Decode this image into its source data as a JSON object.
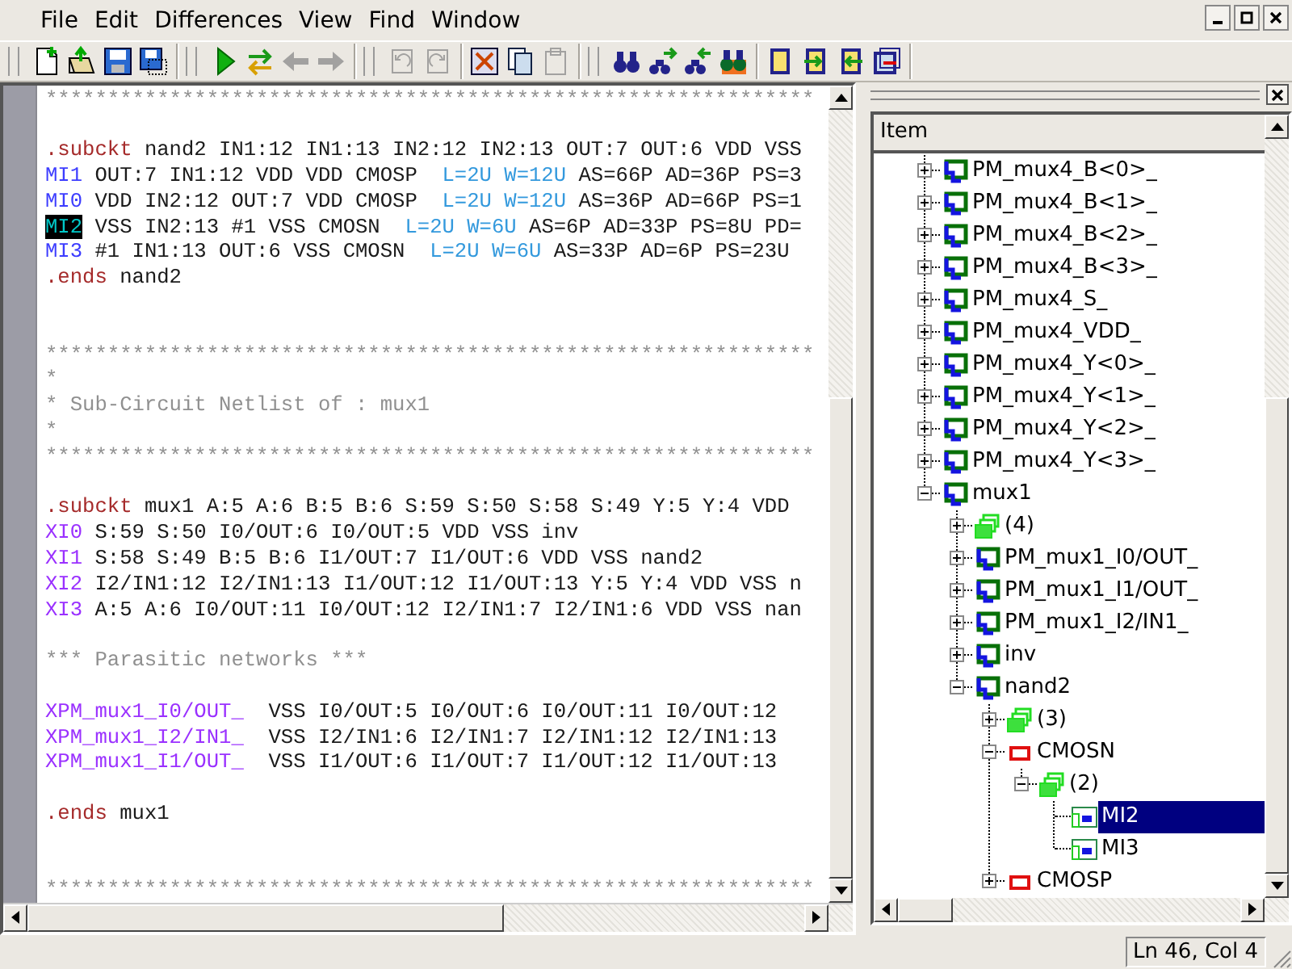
{
  "menu": [
    {
      "label": "File"
    },
    {
      "label": "Edit"
    },
    {
      "label": "Differences"
    },
    {
      "label": "View"
    },
    {
      "label": "Find"
    },
    {
      "label": "Window"
    }
  ],
  "toolbar": [
    {
      "handle": true,
      "buttons": [
        {
          "kind": "new",
          "disabled": false
        },
        {
          "kind": "open",
          "disabled": false
        },
        {
          "kind": "save",
          "disabled": false
        },
        {
          "kind": "saveall",
          "disabled": false
        }
      ]
    },
    {
      "handle": true,
      "buttons": [
        {
          "kind": "run",
          "disabled": false
        },
        {
          "kind": "swap",
          "disabled": false
        },
        {
          "kind": "back",
          "disabled": true
        },
        {
          "kind": "forward",
          "disabled": true
        }
      ]
    },
    {
      "handle": true,
      "buttons": [
        {
          "kind": "undo",
          "disabled": true
        },
        {
          "kind": "redo",
          "disabled": true
        }
      ]
    },
    {
      "handle": false,
      "buttons": [
        {
          "kind": "cut",
          "disabled": false
        },
        {
          "kind": "copy",
          "disabled": false
        },
        {
          "kind": "paste",
          "disabled": true
        }
      ]
    },
    {
      "handle": true,
      "buttons": [
        {
          "kind": "find",
          "disabled": false
        },
        {
          "kind": "findnext",
          "disabled": false
        },
        {
          "kind": "findprev",
          "disabled": false
        },
        {
          "kind": "finddiff",
          "disabled": false
        }
      ]
    },
    {
      "handle": false,
      "buttons": [
        {
          "kind": "dev1",
          "disabled": false
        },
        {
          "kind": "dev2",
          "disabled": false
        },
        {
          "kind": "dev3",
          "disabled": false
        },
        {
          "kind": "dev4",
          "disabled": false
        }
      ]
    }
  ],
  "editor": {
    "lines": [
      {
        "kind": "code",
        "segments": [
          {
            "kind": "comment",
            "text": "**************************************************************"
          }
        ]
      },
      {
        "kind": "blank"
      },
      {
        "kind": "code",
        "segments": [
          {
            "kind": "keyword",
            "text": ".subckt"
          },
          {
            "kind": "plain",
            "text": " nand2 IN1:12 IN1:13 IN2:12 IN2:13 OUT:7 OUT:6 VDD VSS"
          }
        ]
      },
      {
        "kind": "code",
        "segments": [
          {
            "kind": "device",
            "text": "MI1"
          },
          {
            "kind": "plain",
            "text": " OUT:7 IN1:12 VDD VDD CMOSP  "
          },
          {
            "kind": "param",
            "text": "L=2U W=12U"
          },
          {
            "kind": "plain",
            "text": " AS=66P AD=36P PS=3"
          }
        ]
      },
      {
        "kind": "code",
        "segments": [
          {
            "kind": "device",
            "text": "MI0"
          },
          {
            "kind": "plain",
            "text": " VDD IN2:12 OUT:7 VDD CMOSP  "
          },
          {
            "kind": "param",
            "text": "L=2U W=12U"
          },
          {
            "kind": "plain",
            "text": " AS=36P AD=66P PS=1"
          }
        ]
      },
      {
        "kind": "code",
        "segments": [
          {
            "kind": "selection",
            "text": "MI2"
          },
          {
            "kind": "plain",
            "text": " VSS IN2:13 #1 VSS CMOSN  "
          },
          {
            "kind": "param",
            "text": "L=2U W=6U"
          },
          {
            "kind": "plain",
            "text": " AS=6P AD=33P PS=8U PD="
          }
        ]
      },
      {
        "kind": "code",
        "segments": [
          {
            "kind": "device",
            "text": "MI3"
          },
          {
            "kind": "plain",
            "text": " #1 IN1:13 OUT:6 VSS CMOSN  "
          },
          {
            "kind": "param",
            "text": "L=2U W=6U"
          },
          {
            "kind": "plain",
            "text": " AS=33P AD=6P PS=23U"
          }
        ]
      },
      {
        "kind": "code",
        "segments": [
          {
            "kind": "keyword",
            "text": ".ends"
          },
          {
            "kind": "plain",
            "text": " nand2"
          }
        ]
      },
      {
        "kind": "blank"
      },
      {
        "kind": "blank"
      },
      {
        "kind": "code",
        "segments": [
          {
            "kind": "comment",
            "text": "**************************************************************\n*\n* Sub-Circuit Netlist of : mux1\n*\n**************************************************************"
          }
        ]
      },
      {
        "kind": "blank"
      },
      {
        "kind": "code",
        "segments": [
          {
            "kind": "keyword",
            "text": ".subckt"
          },
          {
            "kind": "plain",
            "text": " mux1 A:5 A:6 B:5 B:6 S:59 S:50 S:58 S:49 Y:5 Y:4 VDD"
          }
        ]
      },
      {
        "kind": "code",
        "segments": [
          {
            "kind": "instance",
            "text": "XI0"
          },
          {
            "kind": "plain",
            "text": " S:59 S:50 I0/OUT:6 I0/OUT:5 VDD VSS inv"
          }
        ]
      },
      {
        "kind": "code",
        "segments": [
          {
            "kind": "instance",
            "text": "XI1"
          },
          {
            "kind": "plain",
            "text": " S:58 S:49 B:5 B:6 I1/OUT:7 I1/OUT:6 VDD VSS nand2"
          }
        ]
      },
      {
        "kind": "code",
        "segments": [
          {
            "kind": "instance",
            "text": "XI2"
          },
          {
            "kind": "plain",
            "text": " I2/IN1:12 I2/IN1:13 I1/OUT:12 I1/OUT:13 Y:5 Y:4 VDD VSS n"
          }
        ]
      },
      {
        "kind": "code",
        "segments": [
          {
            "kind": "instance",
            "text": "XI3"
          },
          {
            "kind": "plain",
            "text": " A:5 A:6 I0/OUT:11 I0/OUT:12 I2/IN1:7 I2/IN1:6 VDD VSS nan"
          }
        ]
      },
      {
        "kind": "blank"
      },
      {
        "kind": "code",
        "segments": [
          {
            "kind": "comment",
            "text": "*** Parasitic networks ***"
          }
        ]
      },
      {
        "kind": "blank"
      },
      {
        "kind": "code",
        "segments": [
          {
            "kind": "instance",
            "text": "XPM_mux1_I0/OUT_"
          },
          {
            "kind": "plain",
            "text": "  VSS I0/OUT:5 I0/OUT:6 I0/OUT:11 I0/OUT:12"
          }
        ]
      },
      {
        "kind": "code",
        "segments": [
          {
            "kind": "instance",
            "text": "XPM_mux1_I2/IN1_"
          },
          {
            "kind": "plain",
            "text": "  VSS I2/IN1:6 I2/IN1:7 I2/IN1:12 I2/IN1:13"
          }
        ]
      },
      {
        "kind": "code",
        "segments": [
          {
            "kind": "instance",
            "text": "XPM_mux1_I1/OUT_"
          },
          {
            "kind": "plain",
            "text": "  VSS I1/OUT:6 I1/OUT:7 I1/OUT:12 I1/OUT:13"
          }
        ]
      },
      {
        "kind": "blank"
      },
      {
        "kind": "code",
        "segments": [
          {
            "kind": "keyword",
            "text": ".ends"
          },
          {
            "kind": "plain",
            "text": " mux1"
          }
        ]
      },
      {
        "kind": "blank"
      },
      {
        "kind": "blank"
      },
      {
        "kind": "code",
        "segments": [
          {
            "kind": "comment",
            "text": "**************************************************************"
          }
        ]
      }
    ]
  },
  "tree": {
    "header": "Item",
    "items": [
      {
        "kind": "net",
        "label": "PM_mux4_B<0>_",
        "expanded": false,
        "selected": false
      },
      {
        "kind": "net",
        "label": "PM_mux4_B<1>_",
        "expanded": false,
        "selected": false
      },
      {
        "kind": "net",
        "label": "PM_mux4_B<2>_",
        "expanded": false,
        "selected": false
      },
      {
        "kind": "net",
        "label": "PM_mux4_B<3>_",
        "expanded": false,
        "selected": false
      },
      {
        "kind": "net",
        "label": "PM_mux4_S_",
        "expanded": false,
        "selected": false
      },
      {
        "kind": "net",
        "label": "PM_mux4_VDD_",
        "expanded": false,
        "selected": false
      },
      {
        "kind": "net",
        "label": "PM_mux4_Y<0>_",
        "expanded": false,
        "selected": false
      },
      {
        "kind": "net",
        "label": "PM_mux4_Y<1>_",
        "expanded": false,
        "selected": false
      },
      {
        "kind": "net",
        "label": "PM_mux4_Y<2>_",
        "expanded": false,
        "selected": false
      },
      {
        "kind": "net",
        "label": "PM_mux4_Y<3>_",
        "expanded": false,
        "selected": false
      },
      {
        "kind": "net",
        "label": "mux1",
        "expanded": true,
        "selected": false,
        "children": [
          {
            "kind": "group",
            "label": "(4)",
            "expanded": false,
            "selected": false
          },
          {
            "kind": "net",
            "label": "PM_mux1_I0/OUT_",
            "expanded": false,
            "selected": false
          },
          {
            "kind": "net",
            "label": "PM_mux1_I1/OUT_",
            "expanded": false,
            "selected": false
          },
          {
            "kind": "net",
            "label": "PM_mux1_I2/IN1_",
            "expanded": false,
            "selected": false
          },
          {
            "kind": "net",
            "label": "inv",
            "expanded": false,
            "selected": false
          },
          {
            "kind": "net",
            "label": "nand2",
            "expanded": true,
            "selected": false,
            "children": [
              {
                "kind": "group",
                "label": "(3)",
                "expanded": false,
                "selected": false
              },
              {
                "kind": "model",
                "label": "CMOSN",
                "expanded": true,
                "selected": false,
                "children": [
                  {
                    "kind": "group",
                    "label": "(2)",
                    "expanded": true,
                    "selected": false,
                    "children": [
                      {
                        "kind": "instance",
                        "label": "MI2",
                        "selected": true
                      },
                      {
                        "kind": "instance",
                        "label": "MI3",
                        "selected": false
                      }
                    ]
                  }
                ]
              },
              {
                "kind": "model",
                "label": "CMOSP",
                "expanded": false,
                "selected": false
              }
            ]
          }
        ]
      }
    ]
  },
  "status_bar": {
    "position": "Ln 46, Col 4"
  }
}
